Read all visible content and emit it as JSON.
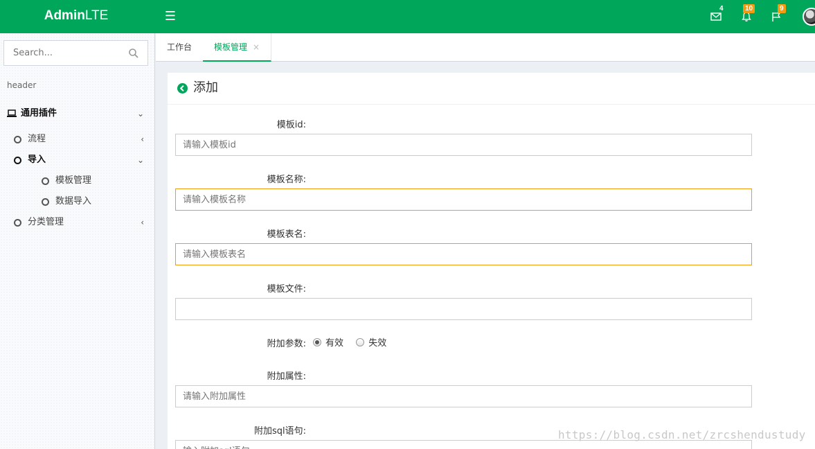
{
  "app": {
    "logo_bold": "Admin",
    "logo_rest": "LTE"
  },
  "header": {
    "mail_count": "4",
    "bell_count": "10",
    "flag_count": "9"
  },
  "sidebar": {
    "search_placeholder": "Search...",
    "section_header": "header",
    "menu": {
      "group": "通用插件",
      "flow": "流程",
      "import": "导入",
      "template_mgmt": "模板管理",
      "data_import": "数据导入",
      "category_mgmt": "分类管理"
    }
  },
  "tabs": [
    {
      "label": "工作台"
    },
    {
      "label": "模板管理",
      "close": "×"
    }
  ],
  "form": {
    "title": "添加",
    "fields": [
      {
        "label": "模板id:",
        "placeholder": "请输入模板id"
      },
      {
        "label": "模板名称:",
        "placeholder": "请输入模板名称"
      },
      {
        "label": "模板表名:",
        "placeholder": "请输入模板表名"
      },
      {
        "label": "模板文件:",
        "placeholder": ""
      },
      {
        "label": "附加参数:",
        "options": [
          "有效",
          "失效"
        ],
        "selected": "有效"
      },
      {
        "label": "附加属性:",
        "placeholder": "请输入附加属性"
      },
      {
        "label": "附加sql语句:",
        "placeholder": "输入附加sql语句"
      }
    ]
  },
  "watermark": "https://blog.csdn.net/zrcshendustudy",
  "colors": {
    "brand": "#00a65a",
    "warning": "#f39c12"
  }
}
